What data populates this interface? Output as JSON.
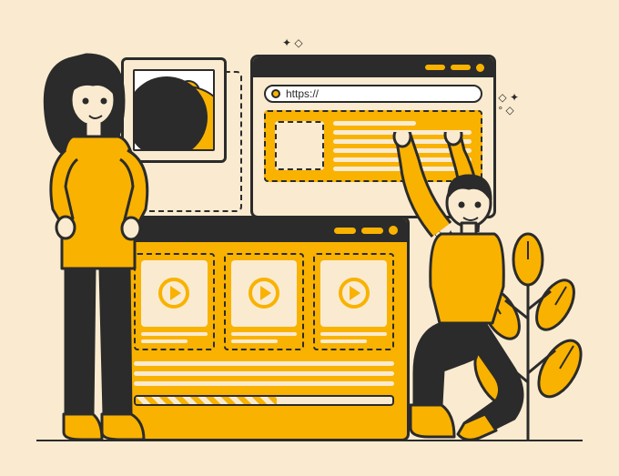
{
  "browser": {
    "url": "https://"
  },
  "colors": {
    "accent": "#f9b200",
    "dark": "#2b2b2b",
    "background": "#faebd0"
  }
}
